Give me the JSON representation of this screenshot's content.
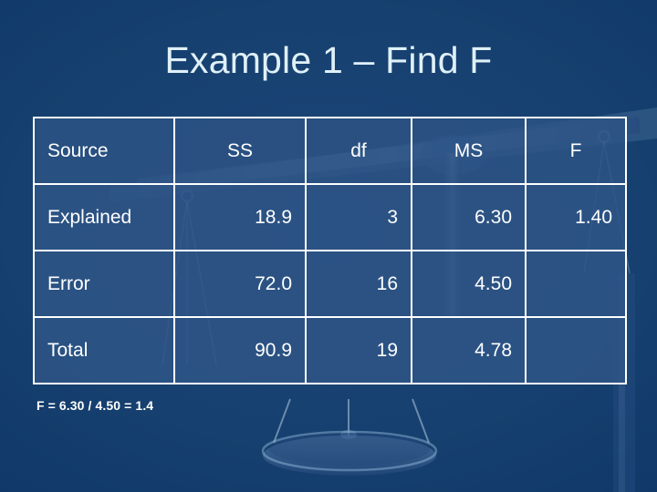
{
  "slide": {
    "title": "Example 1 – Find F",
    "footnote": "F = 6.30 / 4.50 = 1.4",
    "background_art": "balance-scale",
    "colors": {
      "background_dark": "#0c3570",
      "background_mid": "#1d4679",
      "title_text": "#dff0f7",
      "table_fill": "#2d5485",
      "table_border": "#ffffff",
      "body_text": "#ffffff"
    }
  },
  "table": {
    "columns": [
      {
        "key": "source",
        "header": "Source",
        "align": "left"
      },
      {
        "key": "ss",
        "header": "SS",
        "align": "center"
      },
      {
        "key": "df",
        "header": "df",
        "align": "center"
      },
      {
        "key": "ms",
        "header": "MS",
        "align": "center"
      },
      {
        "key": "f",
        "header": "F",
        "align": "center"
      }
    ],
    "rows": [
      {
        "source": "Explained",
        "ss": "18.9",
        "df": "3",
        "ms": "6.30",
        "f": "1.40"
      },
      {
        "source": "Error",
        "ss": "72.0",
        "df": "16",
        "ms": "4.50",
        "f": ""
      },
      {
        "source": "Total",
        "ss": "90.9",
        "df": "19",
        "ms": "4.78",
        "f": ""
      }
    ]
  }
}
